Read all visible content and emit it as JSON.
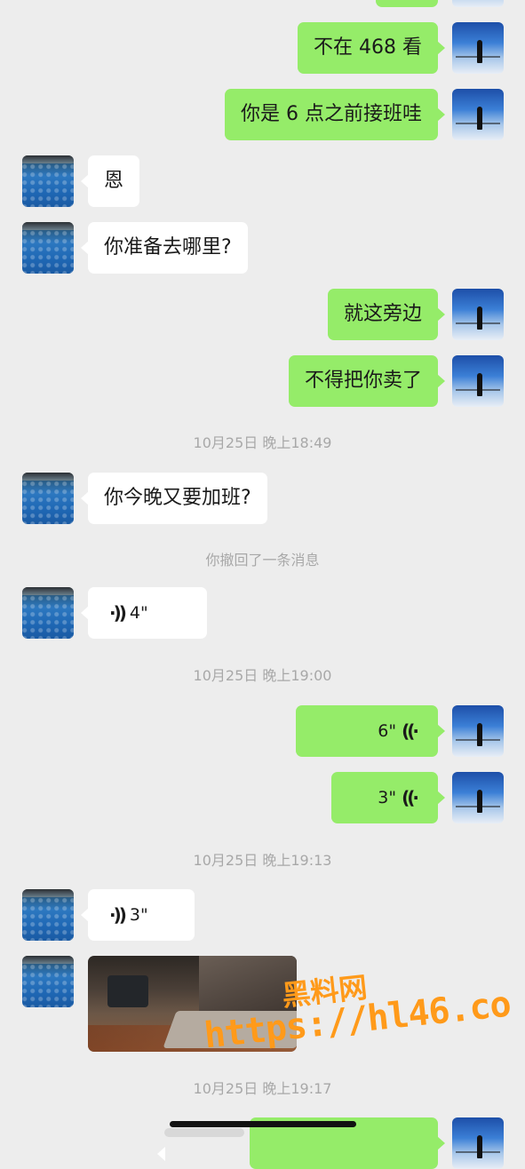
{
  "messages": {
    "m1": "不在 468 看",
    "m2": "你是 6 点之前接班哇",
    "m3": "恩",
    "m4": "你准备去哪里?",
    "m5": "就这旁边",
    "m6": "不得把你卖了",
    "m7": "你今晚又要加班?"
  },
  "voice": {
    "v1": "4\"",
    "v2": "6\"",
    "v3": "3\"",
    "v4": "3\"",
    "wave_left": "·))",
    "wave_right": "((·"
  },
  "timestamps": {
    "t1": "10月25日 晚上18:49",
    "t2": "10月25日 晚上19:00",
    "t3": "10月25日 晚上19:13",
    "t4": "10月25日 晚上19:17"
  },
  "system": {
    "recall": "你撤回了一条消息"
  },
  "watermark": {
    "line1": "黑料网",
    "line2": "https://hl46.co"
  },
  "colors": {
    "background": "#ededed",
    "sent_bubble": "#95ec69",
    "received_bubble": "#ffffff",
    "watermark": "#ff9a1a"
  },
  "icons": {
    "avatar_contact": "sea-avatar",
    "avatar_self": "sky-figure-avatar",
    "voice": "voice-wave-icon"
  }
}
